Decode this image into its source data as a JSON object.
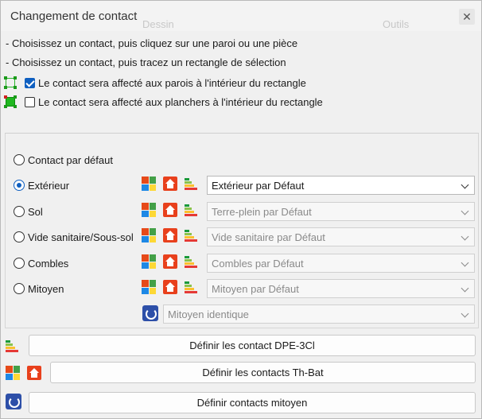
{
  "window": {
    "title": "Changement de contact",
    "close_glyph": "✕",
    "background_tabs": [
      "Dessin",
      "Outils"
    ]
  },
  "instructions": [
    "- Choisissez un contact, puis cliquez sur une paroi ou une pièce",
    "- Choisissez un contact, puis tracez un rectangle de sélection"
  ],
  "selection_options": [
    {
      "label": "Le contact sera affecté aux parois à l'intérieur du rectangle",
      "checked": true,
      "icon": "rectangle-outline-icon"
    },
    {
      "label": "Le contact sera affecté aux planchers à l'intérieur du rectangle",
      "checked": false,
      "icon": "rectangle-filled-icon"
    }
  ],
  "contacts": [
    {
      "label": "Contact par défaut",
      "checked": false,
      "value": null
    },
    {
      "label": "Extérieur",
      "checked": true,
      "value": "Extérieur par Défaut"
    },
    {
      "label": "Sol",
      "checked": false,
      "value": "Terre-plein par Défaut"
    },
    {
      "label": "Vide sanitaire/Sous-sol",
      "checked": false,
      "value": "Vide sanitaire par Défaut"
    },
    {
      "label": "Combles",
      "checked": false,
      "value": "Combles par Défaut"
    },
    {
      "label": "Mitoyen",
      "checked": false,
      "value": "Mitoyen par Défaut"
    }
  ],
  "mitoyen_identique": "Mitoyen identique",
  "buttons": {
    "dpe": "Définir les contact DPE-3Cl",
    "thbat": "Définir les contacts Th-Bat",
    "mitoyen": "Définir contacts mitoyen"
  },
  "colors": {
    "accent": "#0f5fc0",
    "house": "#e8401c",
    "mitoyen": "#2d4fa8",
    "rect_green": "#1fb81f",
    "rect_red": "#d02020"
  }
}
